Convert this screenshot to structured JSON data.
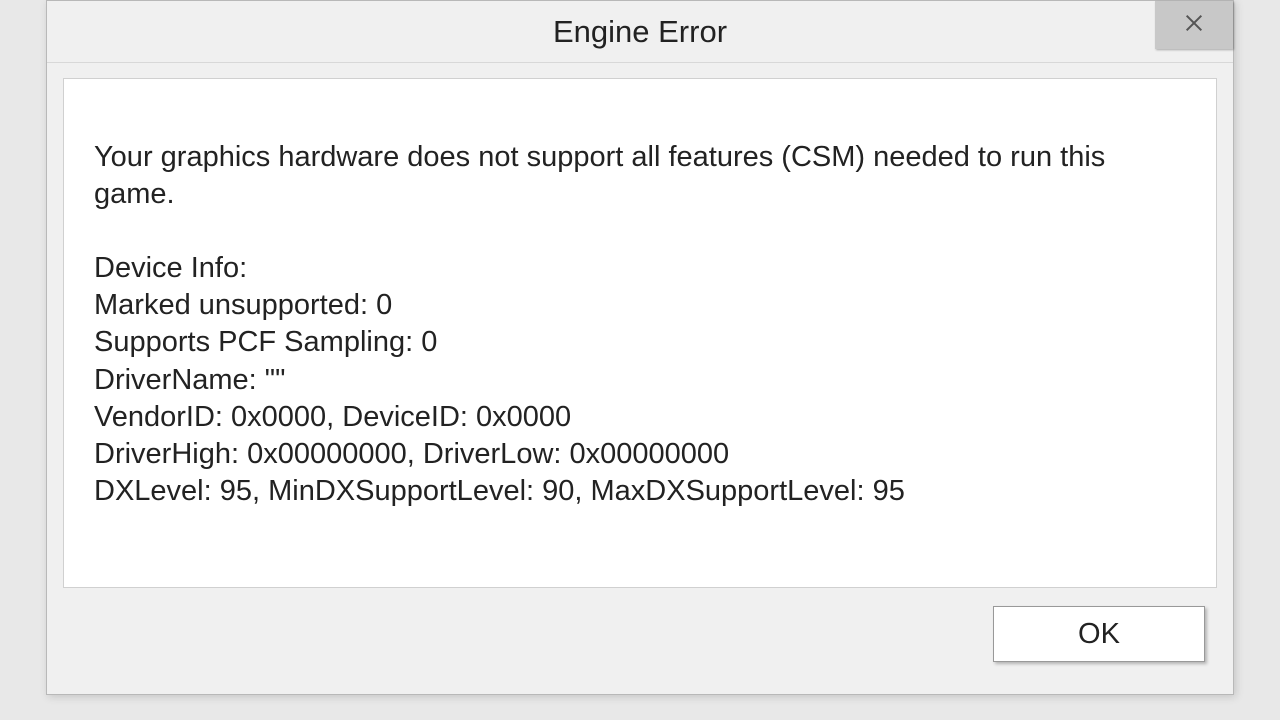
{
  "dialog": {
    "title": "Engine Error",
    "message": "Your graphics hardware does not support all features (CSM) needed to run this game.",
    "device_info_header": "Device Info:",
    "lines": {
      "marked_unsupported": "Marked unsupported: 0",
      "supports_pcf": "Supports PCF Sampling: 0",
      "driver_name": "DriverName: \"\"",
      "vendor_device": "VendorID: 0x0000, DeviceID: 0x0000",
      "driver_high_low": "DriverHigh: 0x00000000, DriverLow: 0x00000000",
      "dx_level": "DXLevel: 95, MinDXSupportLevel: 90, MaxDXSupportLevel: 95"
    },
    "ok_label": "OK"
  }
}
